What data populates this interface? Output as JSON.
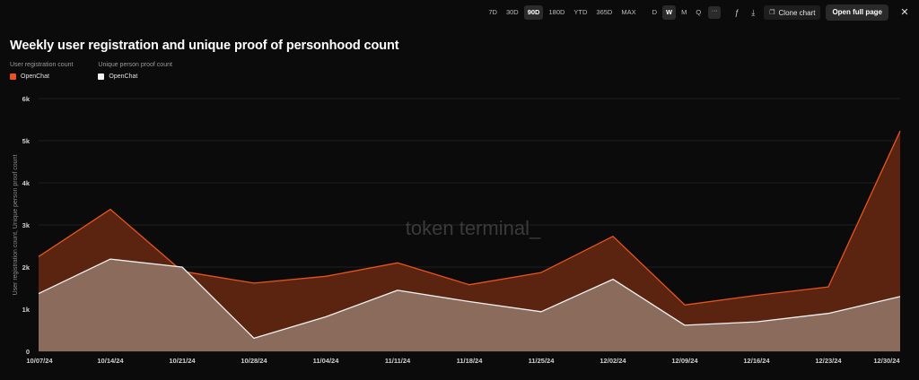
{
  "toolbar": {
    "ranges": [
      "7D",
      "30D",
      "90D",
      "180D",
      "YTD",
      "365D",
      "MAX"
    ],
    "active_range": "90D",
    "granularity": [
      "D",
      "W",
      "M",
      "Q"
    ],
    "active_granularity": "W",
    "more_label": "···",
    "clone_label": "Clone chart",
    "open_label": "Open full page",
    "close_label": "✕"
  },
  "chart_title": "Weekly user registration and unique proof of personhood count",
  "legend": [
    {
      "heading": "User registration count",
      "item": "OpenChat",
      "color": "#e8531f"
    },
    {
      "heading": "Unique person proof count",
      "item": "OpenChat",
      "color": "#f2f2f2"
    }
  ],
  "watermark": "token terminal_",
  "chart_data": {
    "type": "area",
    "title": "Weekly user registration and unique proof of personhood count",
    "xlabel": "",
    "ylabel": "User registration count, Unique person proof count",
    "categories": [
      "10/07/24",
      "10/14/24",
      "10/21/24",
      "10/28/24",
      "11/04/24",
      "11/11/24",
      "11/18/24",
      "11/25/24",
      "12/02/24",
      "12/09/24",
      "12/16/24",
      "12/23/24",
      "12/30/24"
    ],
    "ylim": [
      0,
      6000
    ],
    "yticks": [
      0,
      1000,
      2000,
      3000,
      4000,
      5000,
      6000
    ],
    "ytick_labels": [
      "0",
      "1k",
      "2k",
      "3k",
      "4k",
      "5k",
      "6k"
    ],
    "grid": true,
    "legend_position": "top-left",
    "series": [
      {
        "name": "User registration count — OpenChat",
        "color": "#e8531f",
        "fill": "#5a2410",
        "values": [
          2250,
          3370,
          1900,
          1620,
          1780,
          2100,
          1580,
          1870,
          2730,
          1100,
          1330,
          1530,
          5230
        ]
      },
      {
        "name": "Unique person proof count — OpenChat",
        "color": "#f2f2f2",
        "fill": "#8a6b5c",
        "values": [
          1370,
          2190,
          2000,
          310,
          820,
          1450,
          1180,
          940,
          1710,
          620,
          700,
          900,
          1300
        ]
      }
    ]
  }
}
